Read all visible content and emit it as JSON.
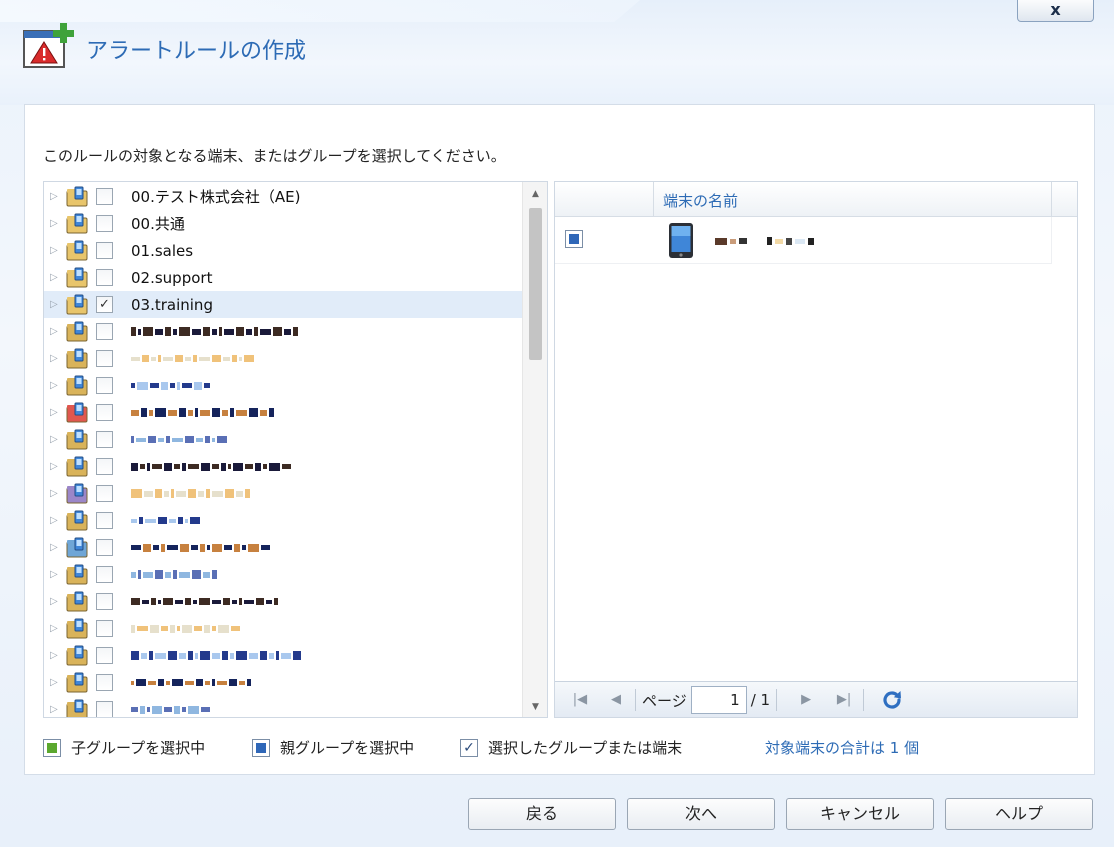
{
  "window": {
    "title": "アラートルールの作成",
    "close_label": "x"
  },
  "instruction": "このルールの対象となる端末、またはグループを選択してください。",
  "tree": {
    "items": [
      {
        "label": "00.テスト株式会社（AE)",
        "checked": false,
        "icon": "folder-icon"
      },
      {
        "label": "00.共通",
        "checked": false,
        "icon": "folder-icon"
      },
      {
        "label": "01.sales",
        "checked": false,
        "icon": "folder-icon"
      },
      {
        "label": "02.support",
        "checked": false,
        "icon": "folder-icon"
      },
      {
        "label": "03.training",
        "checked": true,
        "icon": "folder-icon"
      }
    ],
    "masked_rows": [
      {
        "icon": "folder-icon",
        "color": "#d9b35a"
      },
      {
        "icon": "folder-icon",
        "color": "#d9b35a"
      },
      {
        "icon": "folder-icon",
        "color": "#d9b35a"
      },
      {
        "icon": "folder-alert-icon",
        "color": "#e0574f"
      },
      {
        "icon": "folder-icon",
        "color": "#d9b35a"
      },
      {
        "icon": "folder-icon",
        "color": "#d9b35a"
      },
      {
        "icon": "folder-purple-icon",
        "color": "#9b86c8"
      },
      {
        "icon": "folder-icon",
        "color": "#d9b35a"
      },
      {
        "icon": "folder-blue-icon",
        "color": "#6fa6d6"
      },
      {
        "icon": "folder-icon",
        "color": "#d9b35a"
      },
      {
        "icon": "folder-icon",
        "color": "#d9b35a"
      },
      {
        "icon": "folder-icon",
        "color": "#d9b35a"
      },
      {
        "icon": "folder-icon",
        "color": "#d9b35a"
      },
      {
        "icon": "folder-icon",
        "color": "#d9b35a"
      },
      {
        "icon": "folder-icon",
        "color": "#d9b35a"
      }
    ]
  },
  "grid": {
    "column_name": "端末の名前",
    "rows": [
      {
        "checked": true,
        "icon": "smartphone-icon"
      }
    ]
  },
  "pager": {
    "page_label": "ページ",
    "current_page": "1",
    "total": "/ 1"
  },
  "legend": {
    "child_group": "子グループを選択中",
    "parent_group": "親グループを選択中",
    "selected": "選択したグループまたは端末",
    "total": "対象端末の合計は 1 個"
  },
  "buttons": {
    "back": "戻る",
    "next": "次へ",
    "cancel": "キャンセル",
    "help": "ヘルプ"
  },
  "colors": {
    "accent": "#2d6bb5",
    "selected_row": "#e1ecf9",
    "child": "#5ba82e",
    "parent": "#2f67b8"
  }
}
